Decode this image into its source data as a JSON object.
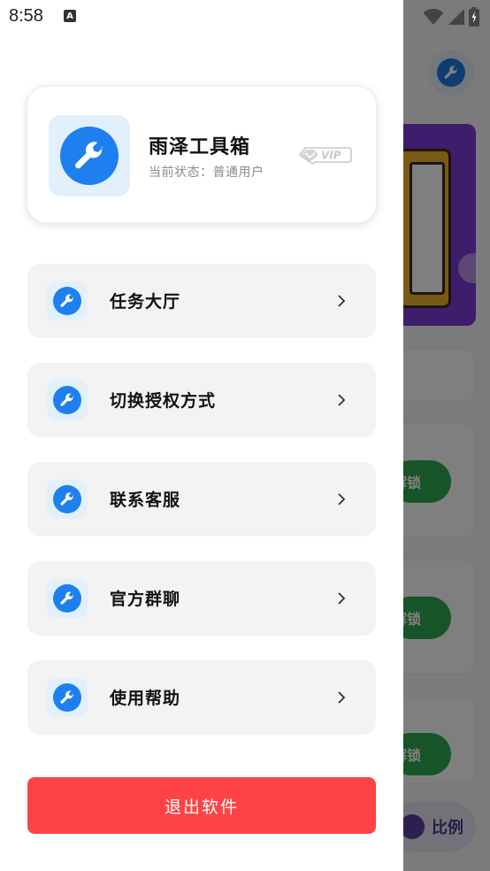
{
  "status_bar": {
    "time": "8:58",
    "notification_icon": "a-icon",
    "wifi_icon": "wifi-icon",
    "signal_icon": "signal-icon",
    "battery_icon": "battery-icon"
  },
  "drawer": {
    "profile": {
      "app_name": "雨泽工具箱",
      "status_label": "当前状态：普通用户",
      "badge": "VIP",
      "logo_icon": "wrench-icon"
    },
    "menu": [
      {
        "label": "任务大厅",
        "icon": "wrench-icon"
      },
      {
        "label": "切换授权方式",
        "icon": "wrench-icon"
      },
      {
        "label": "联系客服",
        "icon": "wrench-icon"
      },
      {
        "label": "官方群聊",
        "icon": "wrench-icon"
      },
      {
        "label": "使用帮助",
        "icon": "wrench-icon"
      }
    ],
    "exit_label": "退出软件"
  },
  "background": {
    "unlock_label": "解锁",
    "ratio_label": "比例"
  },
  "colors": {
    "accent_blue": "#1e80ee",
    "icon_bg": "#e2f0fc",
    "exit_red": "#fe4346",
    "menu_bg": "#f3f3f3",
    "unlock_green": "#2fa84f"
  }
}
